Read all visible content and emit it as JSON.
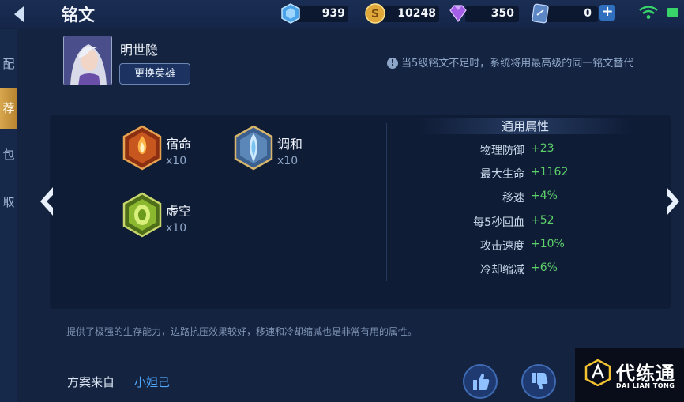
{
  "header": {
    "title": "铭文",
    "resources": [
      {
        "name": "diamond",
        "icon": "diamond-icon",
        "value": "939"
      },
      {
        "name": "gold",
        "icon": "gold-coin-icon",
        "value": "10248"
      },
      {
        "name": "gem",
        "icon": "gem-icon",
        "value": "350"
      },
      {
        "name": "ticket",
        "icon": "ticket-icon",
        "value": "0"
      }
    ],
    "plus_label": "+"
  },
  "side_tabs": [
    {
      "label": "配",
      "active": false
    },
    {
      "label": "荐",
      "active": true
    },
    {
      "label": "包",
      "active": false
    },
    {
      "label": "取",
      "active": false
    }
  ],
  "hero": {
    "name": "明世隐",
    "change_button": "更换英雄"
  },
  "notice": {
    "icon": "!",
    "text": "当5级铭文不足时，系统将用最高级的同一铭文替代"
  },
  "runes": [
    {
      "name": "宿命",
      "count": "x10",
      "color": "#c8571f"
    },
    {
      "name": "调和",
      "count": "x10",
      "color": "#5b87b8"
    },
    {
      "name": "虚空",
      "count": "x10",
      "color": "#8cb82f"
    }
  ],
  "attributes": {
    "title": "通用属性",
    "rows": [
      {
        "name": "物理防御",
        "value": "+23"
      },
      {
        "name": "最大生命",
        "value": "+1162"
      },
      {
        "name": "移速",
        "value": "+4%"
      },
      {
        "name": "每5秒回血",
        "value": "+52"
      },
      {
        "name": "攻击速度",
        "value": "+10%"
      },
      {
        "name": "冷却缩减",
        "value": "+6%"
      }
    ]
  },
  "description": "提供了极强的生存能力，边路抗压效果较好，移速和冷却缩减也是非常有用的属性。",
  "plan": {
    "label": "方案来自",
    "author": "小妲己"
  },
  "watermark": {
    "cn": "代练通",
    "en": "DAI LIAN TONG"
  },
  "colors": {
    "accent": "#d7a64d",
    "positive": "#5dd06a",
    "link": "#4fa7ff"
  }
}
